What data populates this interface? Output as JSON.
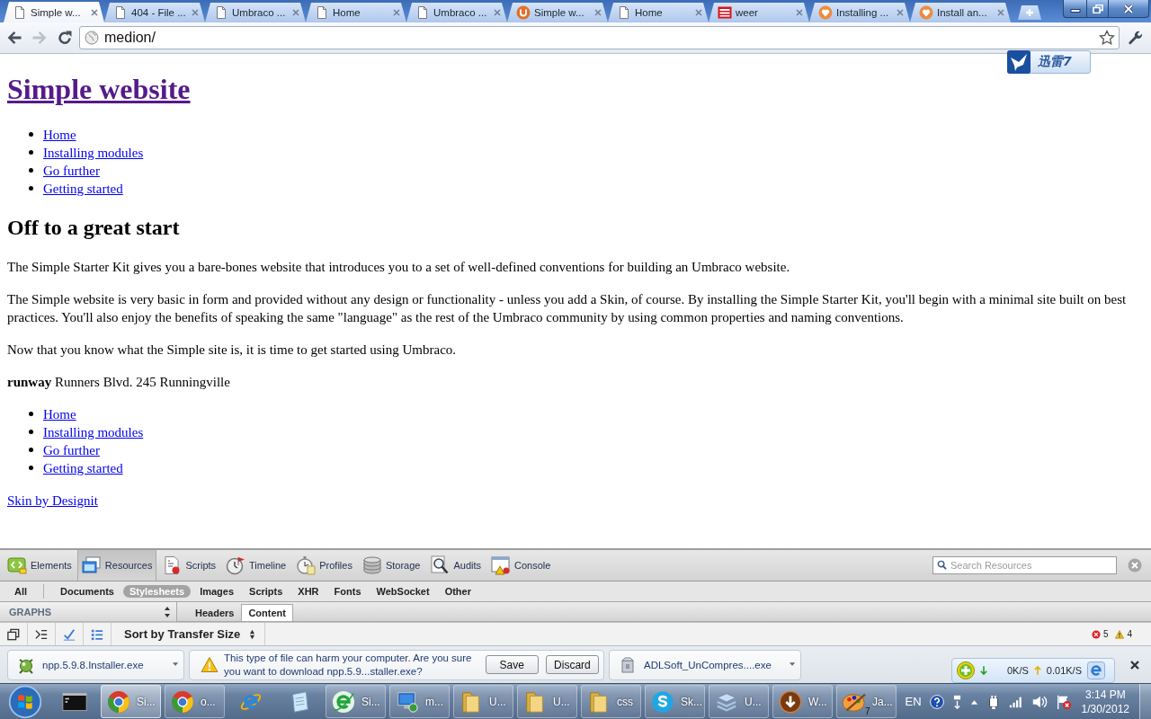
{
  "tabs": [
    {
      "title": "Simple w...",
      "kind": "page",
      "selected": true
    },
    {
      "title": "404 - File ...",
      "kind": "page",
      "selected": false
    },
    {
      "title": "Umbraco ...",
      "kind": "page",
      "selected": false
    },
    {
      "title": "Home",
      "kind": "page",
      "selected": false
    },
    {
      "title": "Umbraco ...",
      "kind": "page",
      "selected": false
    },
    {
      "title": "Simple w...",
      "kind": "umbraco",
      "selected": false
    },
    {
      "title": "Home",
      "kind": "page",
      "selected": false
    },
    {
      "title": "weer",
      "kind": "news",
      "selected": false
    },
    {
      "title": "Installing ...",
      "kind": "heart",
      "selected": false
    },
    {
      "title": "Install an...",
      "kind": "heart",
      "selected": false
    }
  ],
  "toolbar": {
    "nav_buttons": [
      {
        "kind": "back",
        "disabled": false
      },
      {
        "kind": "forward",
        "disabled": true
      },
      {
        "kind": "reload",
        "disabled": false
      }
    ],
    "address": "medion/"
  },
  "floating_widget": {
    "label": "迅雷7"
  },
  "page": {
    "title": "Simple website",
    "nav": [
      "Home",
      "Installing modules",
      "Go further",
      "Getting started"
    ],
    "heading": "Off to a great start",
    "paragraphs": [
      "The Simple Starter Kit gives you a bare-bones website that introduces you to a set of well-defined conventions for building an Umbraco website.",
      "The Simple website is very basic in form and provided without any design or functionality - unless you add a Skin, of course. By installing the Simple Starter Kit, you'll begin with a minimal site built on best practices. You'll also enjoy the benefits of speaking the same \"language\" as the rest of the Umbraco community by using common properties and naming conventions.",
      "Now that you know what the Simple site is, it is time to get started using Umbraco."
    ],
    "address": "**runway** Runners Blvd. 245 Runningville",
    "footer_nav": [
      "Home",
      "Installing modules",
      "Go further",
      "Getting started"
    ],
    "credit": "Skin by Designit"
  },
  "devtools": {
    "panels": [
      {
        "kind": "elements",
        "label": "Elements",
        "selected": false
      },
      {
        "kind": "resources",
        "label": "Resources",
        "selected": true
      },
      {
        "kind": "scripts",
        "label": "Scripts",
        "selected": false
      },
      {
        "kind": "timeline",
        "label": "Timeline",
        "selected": false
      },
      {
        "kind": "profiles",
        "label": "Profiles",
        "selected": false
      },
      {
        "kind": "storage",
        "label": "Storage",
        "selected": false
      },
      {
        "kind": "audits",
        "label": "Audits",
        "selected": false
      },
      {
        "kind": "console",
        "label": "Console",
        "selected": false
      }
    ],
    "search": {
      "placeholder": "Search Resources"
    },
    "filters": [
      {
        "label": "All",
        "selected": false
      },
      {
        "label": "Documents",
        "selected": false
      },
      {
        "label": "Stylesheets",
        "selected": true
      },
      {
        "label": "Images",
        "selected": false
      },
      {
        "label": "Scripts",
        "selected": false
      },
      {
        "label": "XHR",
        "selected": false
      },
      {
        "label": "Fonts",
        "selected": false
      },
      {
        "label": "WebSocket",
        "selected": false
      },
      {
        "label": "Other",
        "selected": false
      }
    ],
    "sidebar": {
      "header": "GRAPHS"
    },
    "view_tabs": [
      {
        "label": "Headers",
        "selected": false
      },
      {
        "label": "Content",
        "selected": true
      }
    ],
    "status_bar": {
      "sort": "Sort by Transfer Size",
      "errors": "5",
      "warnings": "4"
    }
  },
  "downloads": [
    {
      "kind": "program",
      "name": "npp.5.9.8.Installer.exe"
    },
    {
      "kind": "warning",
      "message": "This type of file can harm your computer. Are you sure you want to download npp.5.9...staller.exe?",
      "buttons": [
        "Save",
        "Discard"
      ]
    },
    {
      "kind": "package",
      "name": "ADLSoft_UnCompres....exe"
    }
  ],
  "speed_monitor": {
    "download": "0K/S",
    "upload": "0.01K/S"
  },
  "taskbar": {
    "items": [
      {
        "kind": "terminal",
        "selected": false
      },
      {
        "kind": "chrome",
        "label": "Si...",
        "selected": true
      },
      {
        "kind": "chrome",
        "label": "o...",
        "selected": false
      },
      {
        "kind": "ie",
        "selected": false
      },
      {
        "kind": "notepad",
        "selected": false
      },
      {
        "kind": "green-e",
        "label": "Si...",
        "selected": false
      },
      {
        "kind": "computer",
        "label": "m...",
        "selected": false
      },
      {
        "kind": "folder",
        "label": "U...",
        "selected": false
      },
      {
        "kind": "folder",
        "label": "U...",
        "selected": false
      },
      {
        "kind": "folder",
        "label": "css",
        "selected": false
      },
      {
        "kind": "skype",
        "label": "Sk...",
        "selected": false
      },
      {
        "kind": "layers",
        "label": "U...",
        "selected": false
      },
      {
        "kind": "downloader",
        "label": "W...",
        "selected": false
      },
      {
        "kind": "palette",
        "label": "Ja...",
        "badge": "7",
        "selected": false
      }
    ],
    "language": "EN",
    "time": "3:14 PM",
    "date": "1/30/2012"
  }
}
